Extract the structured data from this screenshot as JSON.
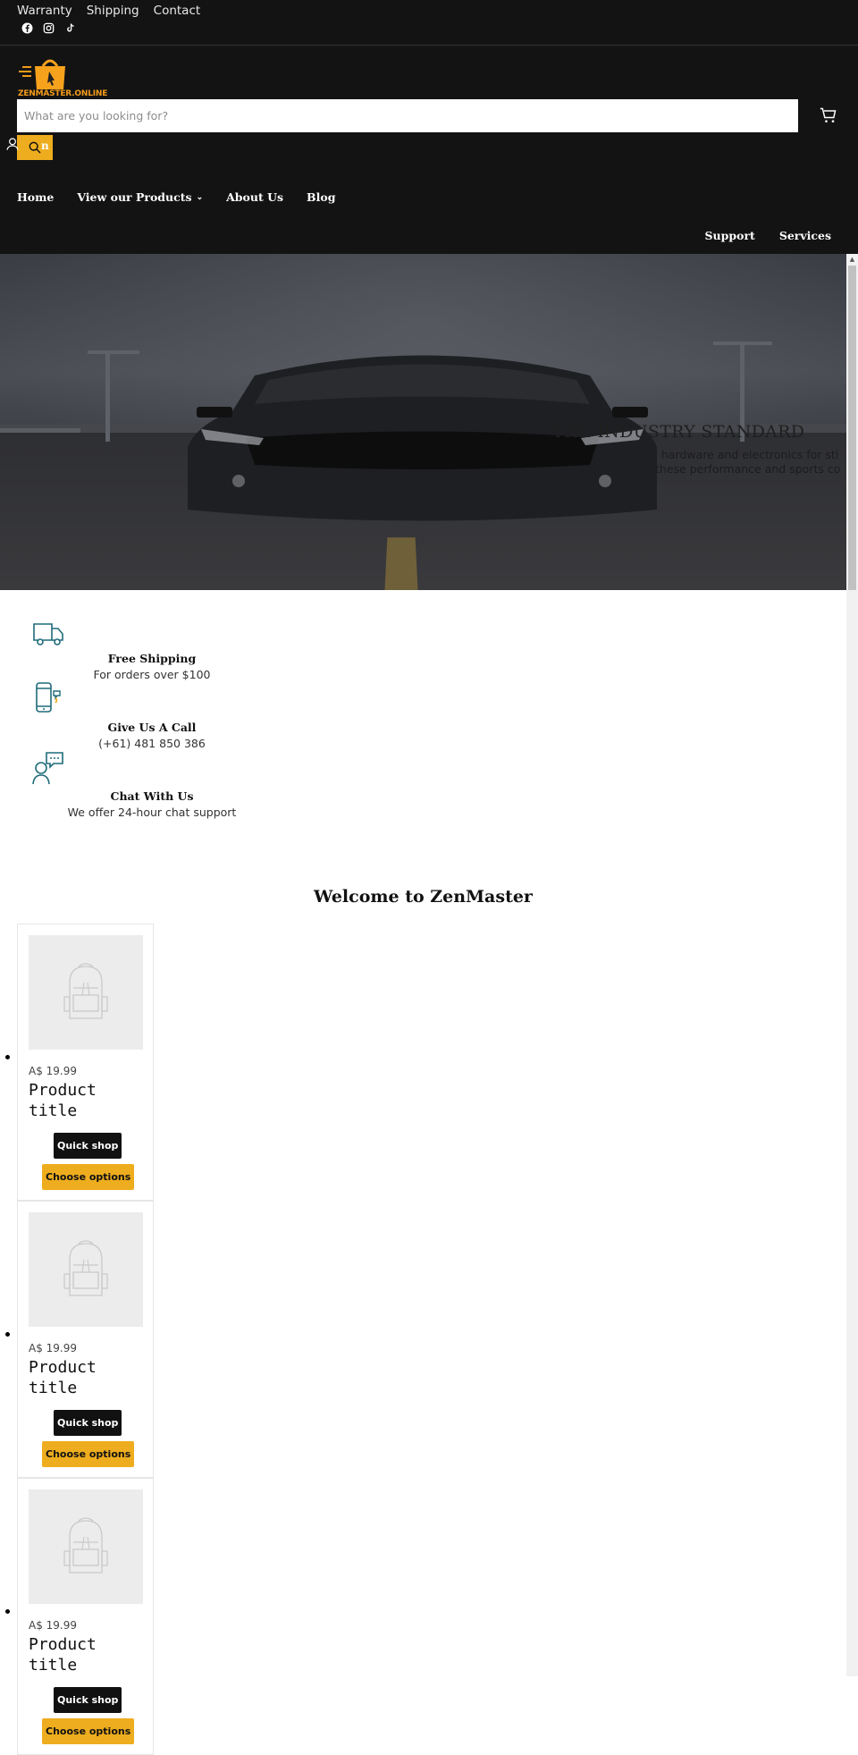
{
  "header": {
    "utility_links": [
      "Warranty",
      "Shipping",
      "Contact"
    ],
    "social_icons": [
      "facebook-icon",
      "instagram-icon",
      "tiktok-icon"
    ],
    "logo_text": "ZENMASTER.ONLINE",
    "search": {
      "placeholder": "What are you looking for?",
      "value": ""
    },
    "account_label": "n",
    "main_nav": [
      {
        "label": "Home",
        "has_dropdown": false
      },
      {
        "label": "View our Products",
        "has_dropdown": true
      },
      {
        "label": "About Us",
        "has_dropdown": false
      },
      {
        "label": "Blog",
        "has_dropdown": false
      }
    ],
    "secondary_nav": [
      "Support",
      "Services"
    ],
    "colors": {
      "background": "#131313",
      "accent": "#eead1e",
      "logo": "#f39a1a"
    }
  },
  "hero": {
    "title": "THE INDUSTRY STANDARD",
    "text_line1": "hardware and electronics for sti",
    "text_line2": "these performance and sports co"
  },
  "features": [
    {
      "icon": "truck-icon",
      "title": "Free Shipping",
      "text": "For orders over $100"
    },
    {
      "icon": "phone-icon",
      "title": "Give Us A Call",
      "text": "(+61) 481 850 386"
    },
    {
      "icon": "chat-support-icon",
      "title": "Chat With Us",
      "text": "We offer 24-hour chat support"
    }
  ],
  "section": {
    "title": "Welcome to ZenMaster"
  },
  "products": [
    {
      "price": "A$ 19.99",
      "title": "Product title",
      "quick_shop": "Quick shop",
      "choose_options": "Choose options"
    },
    {
      "price": "A$ 19.99",
      "title": "Product title",
      "quick_shop": "Quick shop",
      "choose_options": "Choose options"
    },
    {
      "price": "A$ 19.99",
      "title": "Product title",
      "quick_shop": "Quick shop",
      "choose_options": "Choose options"
    }
  ]
}
